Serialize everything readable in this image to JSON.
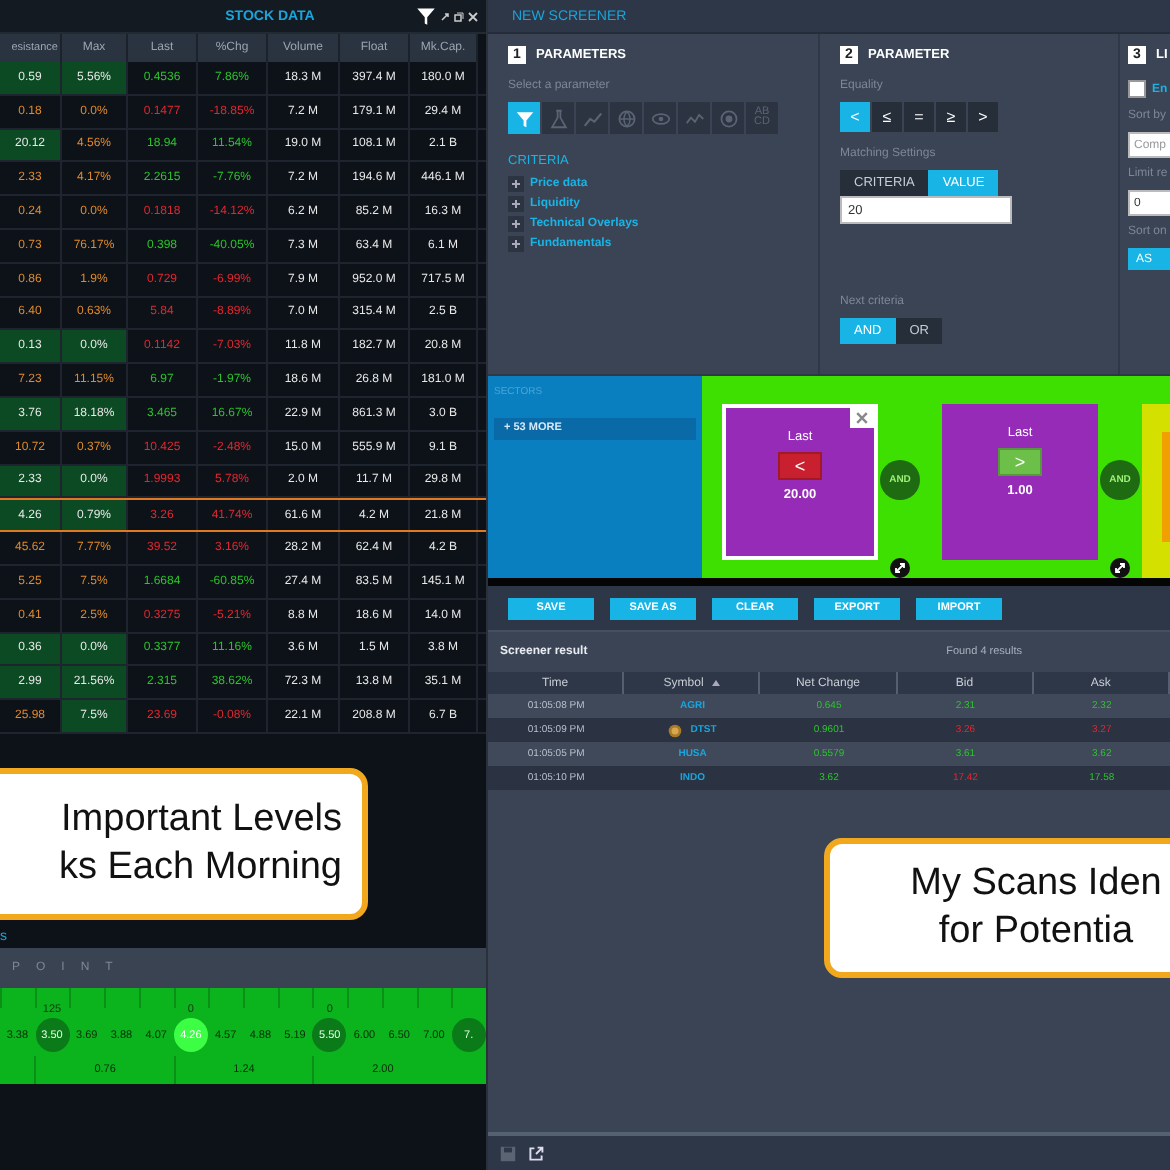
{
  "stock_data": {
    "title": "STOCK DATA",
    "columns": [
      "esistance",
      "Max",
      "Last",
      "%Chg",
      "Volume",
      "Float",
      "Mk.Cap."
    ],
    "rows": [
      {
        "cells": [
          "0.59",
          "5.56%",
          "0.4536",
          "7.86%",
          "18.3 M",
          "397.4 M",
          "180.0 M"
        ],
        "highlight": [
          true,
          true
        ],
        "up": true,
        "selected": false
      },
      {
        "cells": [
          "0.18",
          "0.0%",
          "0.1477",
          "-18.85%",
          "7.2 M",
          "179.1 M",
          "29.4 M"
        ],
        "highlight": [
          false,
          false
        ],
        "up": false,
        "selected": false
      },
      {
        "cells": [
          "20.12",
          "4.56%",
          "18.94",
          "11.54%",
          "19.0 M",
          "108.1 M",
          "2.1 B"
        ],
        "highlight": [
          true,
          false
        ],
        "up": true,
        "selected": false
      },
      {
        "cells": [
          "2.33",
          "4.17%",
          "2.2615",
          "-7.76%",
          "7.2 M",
          "194.6 M",
          "446.1 M"
        ],
        "highlight": [
          false,
          false
        ],
        "up": true,
        "selected": false
      },
      {
        "cells": [
          "0.24",
          "0.0%",
          "0.1818",
          "-14.12%",
          "6.2 M",
          "85.2 M",
          "16.3 M"
        ],
        "highlight": [
          false,
          false
        ],
        "up": false,
        "selected": false
      },
      {
        "cells": [
          "0.73",
          "76.17%",
          "0.398",
          "-40.05%",
          "7.3 M",
          "63.4 M",
          "6.1 M"
        ],
        "highlight": [
          false,
          false
        ],
        "up": true,
        "selected": false
      },
      {
        "cells": [
          "0.86",
          "1.9%",
          "0.729",
          "-6.99%",
          "7.9 M",
          "952.0 M",
          "717.5 M"
        ],
        "highlight": [
          false,
          false
        ],
        "up": false,
        "selected": false
      },
      {
        "cells": [
          "6.40",
          "0.63%",
          "5.84",
          "-8.89%",
          "7.0 M",
          "315.4 M",
          "2.5 B"
        ],
        "highlight": [
          false,
          false
        ],
        "up": false,
        "selected": false
      },
      {
        "cells": [
          "0.13",
          "0.0%",
          "0.1142",
          "-7.03%",
          "11.8 M",
          "182.7 M",
          "20.8 M"
        ],
        "highlight": [
          true,
          true
        ],
        "up": false,
        "selected": false
      },
      {
        "cells": [
          "7.23",
          "11.15%",
          "6.97",
          "-1.97%",
          "18.6 M",
          "26.8 M",
          "181.0 M"
        ],
        "highlight": [
          false,
          false
        ],
        "up": true,
        "selected": false
      },
      {
        "cells": [
          "3.76",
          "18.18%",
          "3.465",
          "16.67%",
          "22.9 M",
          "861.3 M",
          "3.0 B"
        ],
        "highlight": [
          true,
          true
        ],
        "up": true,
        "selected": false
      },
      {
        "cells": [
          "10.72",
          "0.37%",
          "10.425",
          "-2.48%",
          "15.0 M",
          "555.9 M",
          "9.1 B"
        ],
        "highlight": [
          false,
          false
        ],
        "up": false,
        "selected": false
      },
      {
        "cells": [
          "2.33",
          "0.0%",
          "1.9993",
          "5.78%",
          "2.0 M",
          "11.7 M",
          "29.8 M"
        ],
        "highlight": [
          true,
          true
        ],
        "up": false,
        "selected": false
      },
      {
        "cells": [
          "4.26",
          "0.79%",
          "3.26",
          "41.74%",
          "61.6 M",
          "4.2 M",
          "21.8 M"
        ],
        "highlight": [
          true,
          true
        ],
        "up": false,
        "selected": true
      },
      {
        "cells": [
          "45.62",
          "7.77%",
          "39.52",
          "3.16%",
          "28.2 M",
          "62.4 M",
          "4.2 B"
        ],
        "highlight": [
          false,
          false
        ],
        "up": false,
        "selected": false
      },
      {
        "cells": [
          "5.25",
          "7.5%",
          "1.6684",
          "-60.85%",
          "27.4 M",
          "83.5 M",
          "145.1 M"
        ],
        "highlight": [
          false,
          false
        ],
        "up": true,
        "selected": false
      },
      {
        "cells": [
          "0.41",
          "2.5%",
          "0.3275",
          "-5.21%",
          "8.8 M",
          "18.6 M",
          "14.0 M"
        ],
        "highlight": [
          false,
          false
        ],
        "up": false,
        "selected": false
      },
      {
        "cells": [
          "0.36",
          "0.0%",
          "0.3377",
          "11.16%",
          "3.6 M",
          "1.5 M",
          "3.8 M"
        ],
        "highlight": [
          true,
          true
        ],
        "up": true,
        "selected": false
      },
      {
        "cells": [
          "2.99",
          "21.56%",
          "2.315",
          "38.62%",
          "72.3 M",
          "13.8 M",
          "35.1 M"
        ],
        "highlight": [
          true,
          true
        ],
        "up": true,
        "selected": false
      },
      {
        "cells": [
          "25.98",
          "7.5%",
          "23.69",
          "-0.08%",
          "22.1 M",
          "208.8 M",
          "6.7 B"
        ],
        "highlight": [
          false,
          true
        ],
        "up": false,
        "selected": false
      }
    ]
  },
  "levels": {
    "fragment": "s",
    "label": "POINT",
    "ticks": [
      {
        "label": "3.38",
        "marked": false
      },
      {
        "label": "3.50",
        "marked": true,
        "active": false,
        "above": "125"
      },
      {
        "label": "3.69",
        "marked": false
      },
      {
        "label": "3.88",
        "marked": false
      },
      {
        "label": "4.07",
        "marked": false
      },
      {
        "label": "4.26",
        "marked": true,
        "active": true,
        "above": "0"
      },
      {
        "label": "4.57",
        "marked": false
      },
      {
        "label": "4.88",
        "marked": false
      },
      {
        "label": "5.19",
        "marked": false
      },
      {
        "label": "5.50",
        "marked": true,
        "active": false,
        "above": "0"
      },
      {
        "label": "6.00",
        "marked": false
      },
      {
        "label": "6.50",
        "marked": false
      },
      {
        "label": "7.00",
        "marked": false
      },
      {
        "label": "7.",
        "marked": true,
        "active": false
      }
    ],
    "spans": [
      "0.76",
      "1.24",
      "2.00"
    ]
  },
  "screener": {
    "title": "NEW SCREENER",
    "parameters": {
      "number": "1",
      "title": "PARAMETERS",
      "hint": "Select a parameter",
      "icons": [
        {
          "kind": "filter",
          "selected": true
        },
        {
          "kind": "flask",
          "selected": false
        },
        {
          "kind": "trend",
          "selected": false
        },
        {
          "kind": "globe",
          "selected": false
        },
        {
          "kind": "eye",
          "selected": false
        },
        {
          "kind": "wave",
          "selected": false
        },
        {
          "kind": "coin",
          "selected": false
        },
        {
          "kind": "text",
          "label": "AB CD",
          "selected": false
        }
      ],
      "criteria_title": "CRITERIA",
      "criteria": [
        {
          "label": "Price data",
          "expanded": false
        },
        {
          "label": "Liquidity",
          "expanded": false
        },
        {
          "label": "Technical Overlays",
          "expanded": false
        },
        {
          "label": "Fundamentals",
          "expanded": false
        }
      ]
    },
    "parameter": {
      "number": "2",
      "title": "PARAMETER",
      "equality_label": "Equality",
      "equality": [
        {
          "label": "<",
          "selected": true
        },
        {
          "label": "≤",
          "selected": false
        },
        {
          "label": "=",
          "selected": false
        },
        {
          "label": "≥",
          "selected": false
        },
        {
          "label": ">",
          "selected": false
        }
      ],
      "matching_label": "Matching Settings",
      "matching": [
        {
          "label": "CRITERIA",
          "selected": false
        },
        {
          "label": "VALUE",
          "selected": true
        }
      ],
      "value": "20",
      "next_label": "Next criteria",
      "next": [
        {
          "label": "AND",
          "selected": true
        },
        {
          "label": "OR",
          "selected": false
        }
      ]
    },
    "limits": {
      "number": "3",
      "title": "LI",
      "checkbox": {
        "label": "En",
        "checked": false
      },
      "sort_by_label": "Sort by",
      "sort_by_placeholder": "Comp",
      "limit_label": "Limit re",
      "limit_value": "0",
      "sort_on_label": "Sort on",
      "sort_button": "AS"
    },
    "sectors": {
      "title": "SECTORS",
      "more": "+ 53 MORE"
    },
    "cards": [
      {
        "field": "Last",
        "operator": "<",
        "value": "20.00",
        "up": false,
        "selected": true
      },
      {
        "field": "Last",
        "operator": ">",
        "value": "1.00",
        "up": true,
        "selected": false
      }
    ],
    "connectors": [
      "AND",
      "AND"
    ],
    "buttons": [
      "SAVE",
      "SAVE AS",
      "CLEAR",
      "EXPORT",
      "IMPORT"
    ],
    "result": {
      "title": "Screener result",
      "count": "Found 4 results",
      "columns": [
        {
          "label": "Time",
          "sorted": false
        },
        {
          "label": "Symbol",
          "sorted": true
        },
        {
          "label": "Net Change",
          "sorted": false
        },
        {
          "label": "Bid",
          "sorted": false
        },
        {
          "label": "Ask",
          "sorted": false
        }
      ],
      "rows": [
        {
          "time": "01:05:08 PM",
          "coin": false,
          "symbol": "AGRI",
          "values": [
            {
              "text": "0.645",
              "up": true
            },
            {
              "text": "2.31",
              "up": true
            },
            {
              "text": "2.32",
              "up": true
            }
          ]
        },
        {
          "time": "01:05:09 PM",
          "coin": true,
          "symbol": "DTST",
          "values": [
            {
              "text": "0.9601",
              "up": true
            },
            {
              "text": "3.26",
              "up": false
            },
            {
              "text": "3.27",
              "up": false
            }
          ]
        },
        {
          "time": "01:05:05 PM",
          "coin": false,
          "symbol": "HUSA",
          "values": [
            {
              "text": "0.5579",
              "up": true
            },
            {
              "text": "3.61",
              "up": true
            },
            {
              "text": "3.62",
              "up": true
            }
          ]
        },
        {
          "time": "01:05:10 PM",
          "coin": false,
          "symbol": "INDO",
          "values": [
            {
              "text": "3.62",
              "up": true
            },
            {
              "text": "17.42",
              "up": false
            },
            {
              "text": "17.58",
              "up": true
            }
          ]
        }
      ]
    }
  },
  "callouts": [
    {
      "lines": [
        "Important Levels",
        "ks Each Morning"
      ]
    },
    {
      "lines": [
        "My Scans Iden",
        "for Potentia"
      ]
    }
  ]
}
